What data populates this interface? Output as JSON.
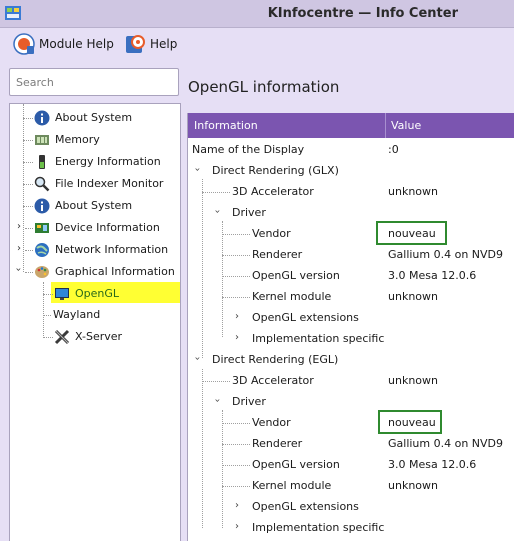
{
  "window": {
    "title": "KInfocentre — Info Center"
  },
  "toolbar": {
    "module_help": "Module Help",
    "help": "Help"
  },
  "search": {
    "placeholder": "Search"
  },
  "sidebar": {
    "items": [
      {
        "label": "About System",
        "icon": "info-icon"
      },
      {
        "label": "Memory",
        "icon": "memory-icon"
      },
      {
        "label": "Energy Information",
        "icon": "battery-icon"
      },
      {
        "label": "File Indexer Monitor",
        "icon": "magnifier-icon"
      },
      {
        "label": "About System",
        "icon": "info-icon"
      },
      {
        "label": "Device Information",
        "icon": "device-icon"
      },
      {
        "label": "Network Information",
        "icon": "globe-icon"
      },
      {
        "label": "Graphical Information",
        "icon": "palette-icon"
      },
      {
        "label": "OpenGL",
        "icon": "monitor-icon"
      },
      {
        "label": "Wayland",
        "icon": ""
      },
      {
        "label": "X-Server",
        "icon": "x-icon"
      }
    ]
  },
  "main": {
    "heading": "OpenGL information",
    "columns": {
      "information": "Information",
      "value": "Value"
    },
    "rows": [
      {
        "key": "Name of the Display",
        "value": ":0"
      },
      {
        "key": "Direct Rendering (GLX)",
        "value": ""
      },
      {
        "key": "3D Accelerator",
        "value": "unknown"
      },
      {
        "key": "Driver",
        "value": ""
      },
      {
        "key": "Vendor",
        "value": "nouveau"
      },
      {
        "key": "Renderer",
        "value": "Gallium 0.4 on NVD9"
      },
      {
        "key": "OpenGL version",
        "value": "3.0 Mesa 12.0.6"
      },
      {
        "key": "Kernel module",
        "value": "unknown"
      },
      {
        "key": "OpenGL extensions",
        "value": ""
      },
      {
        "key": "Implementation specific",
        "value": ""
      },
      {
        "key": "Direct Rendering (EGL)",
        "value": ""
      },
      {
        "key": "3D Accelerator",
        "value": "unknown"
      },
      {
        "key": "Driver",
        "value": ""
      },
      {
        "key": "Vendor",
        "value": "nouveau"
      },
      {
        "key": "Renderer",
        "value": "Gallium 0.4 on NVD9"
      },
      {
        "key": "OpenGL version",
        "value": "3.0 Mesa 12.0.6"
      },
      {
        "key": "Kernel module",
        "value": "unknown"
      },
      {
        "key": "OpenGL extensions",
        "value": ""
      },
      {
        "key": "Implementation specific",
        "value": ""
      }
    ]
  },
  "colors": {
    "header": "#7b55b0",
    "selection": "#ffff33",
    "highlight_box": "#2f8a2f",
    "selected_text": "#2a6a1a"
  }
}
